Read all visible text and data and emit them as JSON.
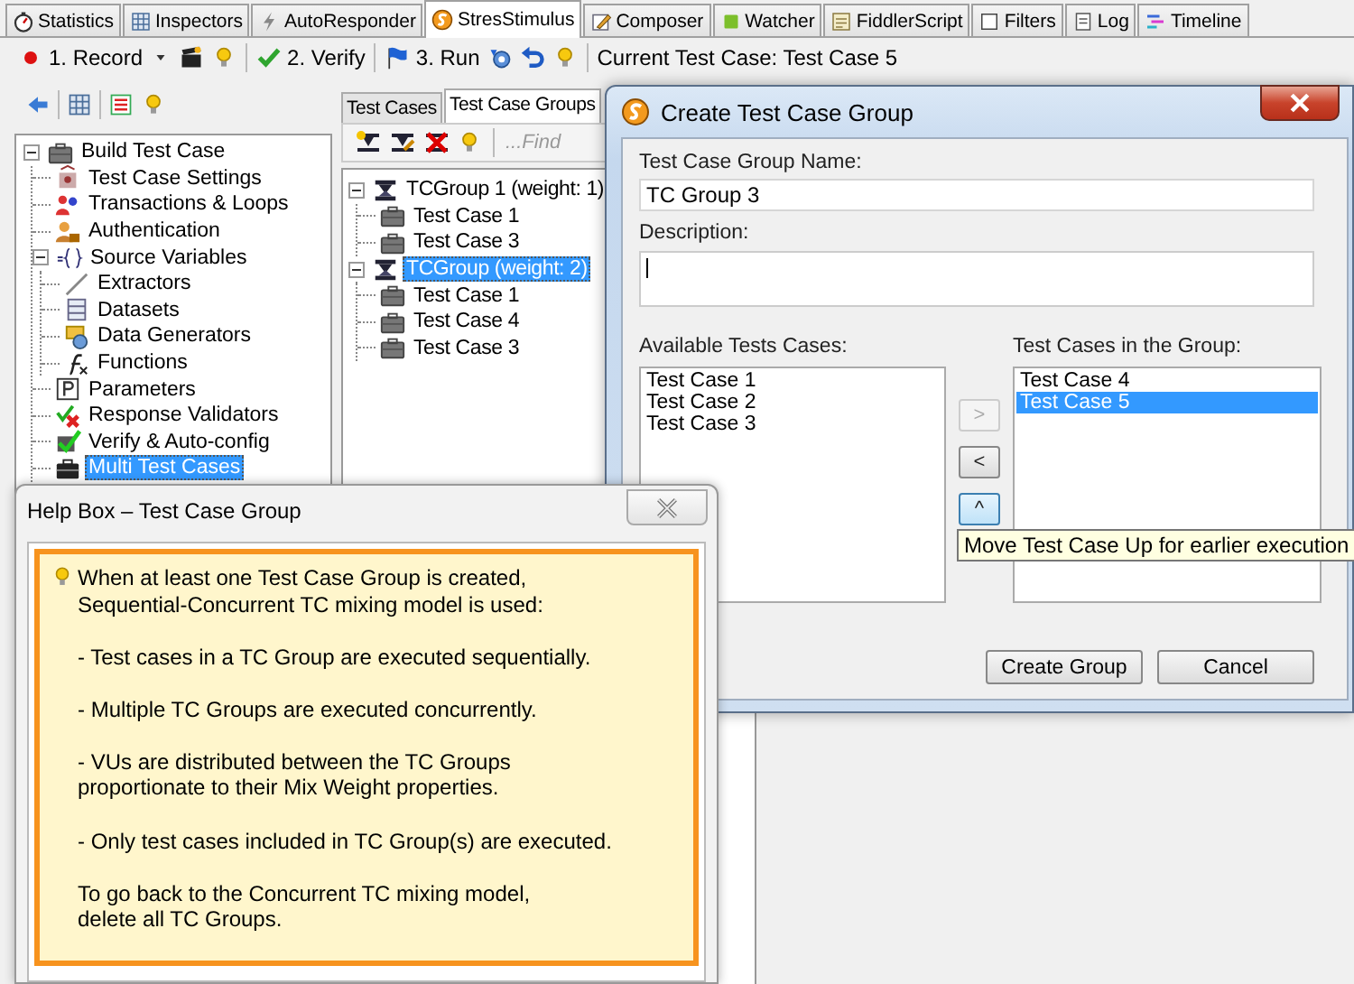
{
  "tabs": [
    {
      "label": "Statistics",
      "selected": false
    },
    {
      "label": "Inspectors",
      "selected": false
    },
    {
      "label": "AutoResponder",
      "selected": false
    },
    {
      "label": "StresStimulus",
      "selected": true
    },
    {
      "label": "Composer",
      "selected": false
    },
    {
      "label": "Watcher",
      "selected": false
    },
    {
      "label": "FiddlerScript",
      "selected": false
    },
    {
      "label": "Filters",
      "selected": false
    },
    {
      "label": "Log",
      "selected": false
    },
    {
      "label": "Timeline",
      "selected": false
    }
  ],
  "toolbar": {
    "record": "1. Record",
    "verify": "2. Verify",
    "run": "3. Run",
    "current_test_case": "Current Test Case: Test Case 5"
  },
  "left_tree": [
    {
      "label": "Build Test Case",
      "expanded": true,
      "selected": false,
      "children": [
        {
          "label": "Test Case Settings",
          "selected": false
        },
        {
          "label": "Transactions & Loops",
          "selected": false
        },
        {
          "label": "Authentication",
          "selected": false
        },
        {
          "label": "Source Variables",
          "expanded": true,
          "selected": false,
          "children": [
            {
              "label": "Extractors",
              "selected": false
            },
            {
              "label": "Datasets",
              "selected": false
            },
            {
              "label": "Data Generators",
              "selected": false
            },
            {
              "label": "Functions",
              "selected": false
            }
          ]
        },
        {
          "label": "Parameters",
          "selected": false
        },
        {
          "label": "Response Validators",
          "selected": false
        },
        {
          "label": "Verify & Auto-config",
          "selected": false
        },
        {
          "label": "Multi Test Cases",
          "selected": true
        }
      ]
    }
  ],
  "middle_panel": {
    "tabs": [
      {
        "label": "Test Cases",
        "selected": false
      },
      {
        "label": "Test Case Groups",
        "selected": true
      }
    ],
    "find": {
      "placeholder": "...Find"
    },
    "tree": [
      {
        "label": "TCGroup 1 (weight: 1)",
        "expanded": true,
        "selected": false,
        "children": [
          {
            "label": "Test Case 1",
            "selected": false
          },
          {
            "label": "Test Case 3",
            "selected": false
          }
        ]
      },
      {
        "label": "TCGroup (weight: 2)",
        "expanded": true,
        "selected": true,
        "children": [
          {
            "label": "Test Case 1",
            "selected": false
          },
          {
            "label": "Test Case 4",
            "selected": false
          },
          {
            "label": "Test Case 3",
            "selected": false
          }
        ]
      }
    ]
  },
  "dialog": {
    "title": "Create Test Case Group",
    "name_label": "Test Case Group Name:",
    "name_value": "TC Group 3",
    "description_label": "Description:",
    "description_focused": true,
    "available_label": "Available Tests Cases:",
    "available": [
      {
        "label": "Test Case 1",
        "selected": false
      },
      {
        "label": "Test Case 2",
        "selected": false
      },
      {
        "label": "Test Case 3",
        "selected": false
      }
    ],
    "in_group_label": "Test Cases in the Group:",
    "in_group": [
      {
        "label": "Test Case 4",
        "selected": false
      },
      {
        "label": "Test Case 5",
        "selected": true
      }
    ],
    "move_buttons": [
      {
        "label": ">",
        "disabled": true,
        "hovered": false
      },
      {
        "label": "<",
        "disabled": false,
        "hovered": false
      },
      {
        "label": "^",
        "disabled": false,
        "hovered": true
      }
    ],
    "tooltip": "Move Test Case Up for earlier execution",
    "buttons": [
      "Create Group",
      "Cancel"
    ]
  },
  "help_box": {
    "title": "Help Box – Test Case Group",
    "paragraphs": [
      "When at least one Test Case Group is created,\nSequential-Concurrent TC mixing model is used:",
      "- Test cases in a TC Group are executed sequentially.",
      "- Multiple TC Groups are executed concurrently.",
      "- VUs are distributed between the TC Groups\nproportionate to their Mix Weight properties.",
      "- Only test cases included in TC Group(s) are executed.",
      "To go back to the Concurrent TC mixing model,\ndelete all TC Groups."
    ]
  }
}
